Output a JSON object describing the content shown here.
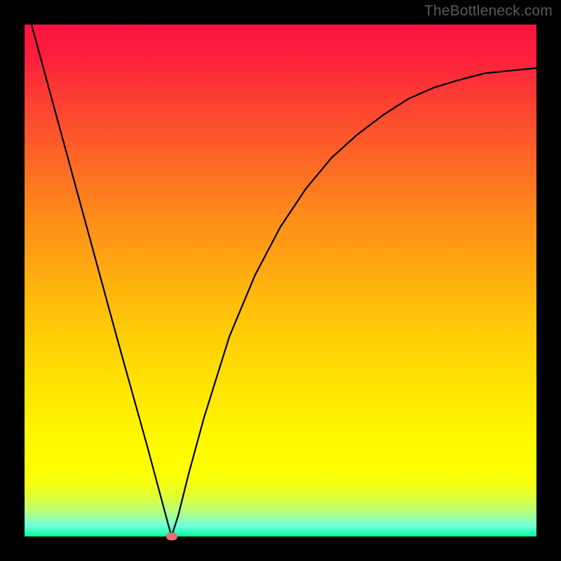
{
  "watermark": {
    "text": "TheBottleneck.com"
  },
  "chart_data": {
    "type": "line",
    "title": "",
    "xlabel": "",
    "ylabel": "",
    "xlim": [
      0,
      1
    ],
    "ylim": [
      0,
      1
    ],
    "series": [
      {
        "name": "curve",
        "x": [
          0.0,
          0.06,
          0.12,
          0.18,
          0.24,
          0.287,
          0.3,
          0.32,
          0.35,
          0.4,
          0.45,
          0.5,
          0.55,
          0.6,
          0.65,
          0.7,
          0.75,
          0.8,
          0.85,
          0.9,
          0.95,
          1.0
        ],
        "y": [
          1.05,
          0.83,
          0.61,
          0.39,
          0.175,
          0.0,
          0.04,
          0.12,
          0.23,
          0.39,
          0.51,
          0.605,
          0.68,
          0.74,
          0.785,
          0.823,
          0.855,
          0.877,
          0.892,
          0.905,
          0.91,
          0.915
        ]
      }
    ],
    "marker": {
      "x": 0.287,
      "y": 0.0,
      "color": "#e66f7a"
    },
    "background_gradient": {
      "direction": "vertical",
      "stops": [
        {
          "pos": 0.0,
          "color": "#fb133e"
        },
        {
          "pos": 0.5,
          "color": "#fec00b"
        },
        {
          "pos": 0.85,
          "color": "#ffff00"
        },
        {
          "pos": 1.0,
          "color": "#00ff9c"
        }
      ]
    }
  }
}
